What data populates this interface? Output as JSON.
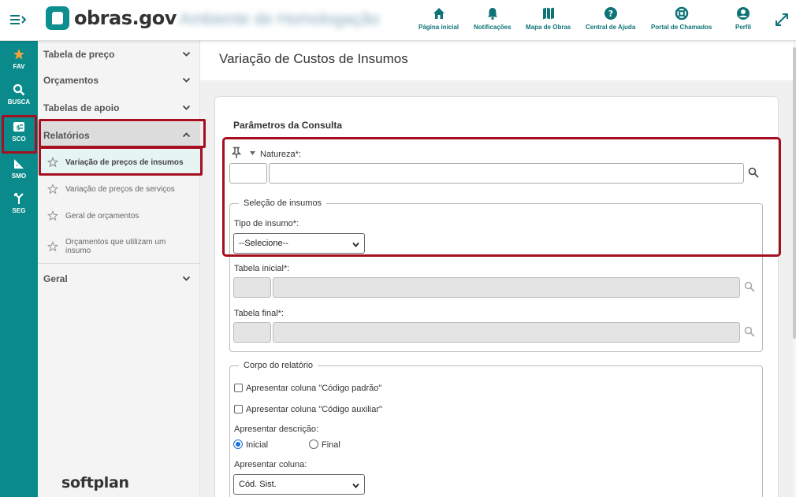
{
  "header": {
    "logo_text": "obras.gov",
    "environment": "Ambiente de Homologação",
    "nav": [
      {
        "label": "Página inicial",
        "icon": "home-icon"
      },
      {
        "label": "Notificações",
        "icon": "bell-icon"
      },
      {
        "label": "Mapa de Obras",
        "icon": "map-icon"
      },
      {
        "label": "Central de Ajuda",
        "icon": "help-icon"
      },
      {
        "label": "Portal de Chamados",
        "icon": "lifebuoy-icon"
      },
      {
        "label": "Perfil",
        "icon": "user-icon"
      }
    ]
  },
  "rail": {
    "items": [
      {
        "label": "FAV",
        "icon": "star-icon"
      },
      {
        "label": "BUSCA",
        "icon": "search-icon"
      },
      {
        "label": "SCO",
        "icon": "sco-icon"
      },
      {
        "label": "SMO",
        "icon": "ruler-icon"
      },
      {
        "label": "SEG",
        "icon": "merge-icon"
      }
    ]
  },
  "sidebar": {
    "groups": [
      {
        "label": "Tabela de preço"
      },
      {
        "label": "Orçamentos"
      },
      {
        "label": "Tabelas de apoio"
      },
      {
        "label": "Relatórios"
      },
      {
        "label": "Geral"
      }
    ],
    "report_items": [
      {
        "label": "Variação de preços de insumos"
      },
      {
        "label": "Variação de preços de serviços"
      },
      {
        "label": "Geral de orçamentos"
      },
      {
        "label": "Orçamentos que utilizam um insumo"
      }
    ],
    "footer_brand": "softplan"
  },
  "page": {
    "title": "Variação de Custos de Insumos"
  },
  "form": {
    "section_title": "Parâmetros da Consulta",
    "natureza_label": "Natureza*:",
    "selecao_legend": "Seleção de insumos",
    "tipo_label": "Tipo de insumo*:",
    "tipo_value": "--Selecione--",
    "tabela_inicial_label": "Tabela inicial*:",
    "tabela_final_label": "Tabela final*:",
    "corpo_legend": "Corpo do relatório",
    "chk_codigo_padrao": "Apresentar coluna \"Código padrão\"",
    "chk_codigo_auxiliar": "Apresentar coluna \"Código auxiliar\"",
    "descricao_label": "Apresentar descrição:",
    "radio_inicial": "Inicial",
    "radio_final": "Final",
    "coluna_label": "Apresentar coluna:",
    "coluna_value": "Cód. Sist."
  },
  "colors": {
    "brand_teal": "#0b8a8c",
    "highlight_red": "#a50f20",
    "nav_text": "#0d7377"
  }
}
